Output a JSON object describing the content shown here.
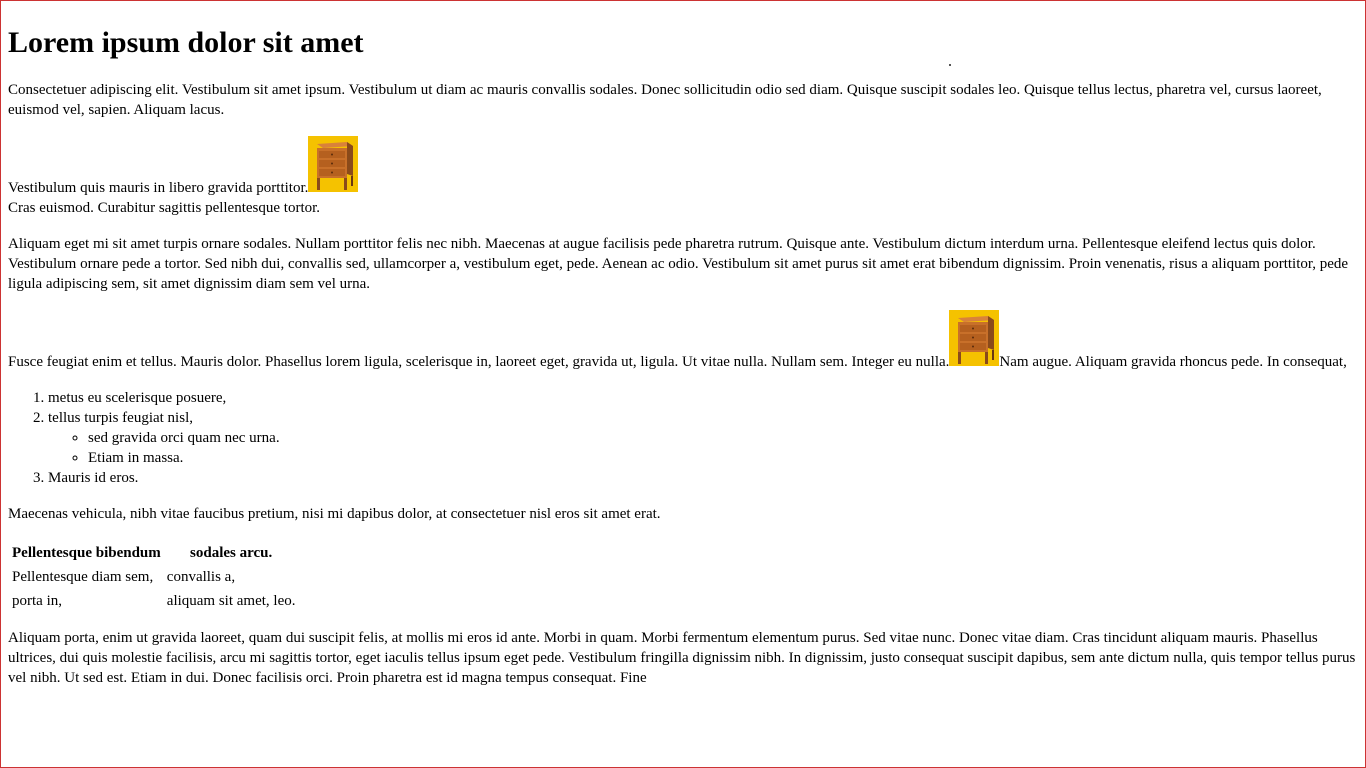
{
  "page": {
    "title": "Lorem ipsum dolor sit amet",
    "para1": "Consectetuer adipiscing elit. Vestibulum sit amet ipsum. Vestibulum ut diam ac mauris convallis sodales. Donec sollicitudin odio sed diam. Quisque suscipit sodales leo. Quisque tellus lectus, pharetra vel, cursus laoreet, euismod vel, sapien. Aliquam lacus.",
    "para2_line1": "Vestibulum quis mauris in libero gravida porttitor.",
    "para2_line2": "Cras euismod. Curabitur sagittis pellentesque tortor.",
    "para3": "Aliquam eget mi sit amet turpis ornare sodales. Nullam porttitor felis nec nibh. Maecenas at augue facilisis pede pharetra rutrum. Quisque ante. Vestibulum dictum interdum urna. Pellentesque eleifend lectus quis dolor. Vestibulum ornare pede a tortor. Sed nibh dui, convallis sed, ullamcorper a, vestibulum eget, pede. Aenean ac odio. Vestibulum sit amet purus sit amet erat bibendum dignissim. Proin venenatis, risus a aliquam porttitor, pede ligula adipiscing sem, sit amet dignissim diam sem vel urna.",
    "para4_before": "Fusce feugiat enim et tellus. Mauris dolor. Phasellus lorem ligula, scelerisque in, laoreet eget, gravida ut, ligula. Ut vitae nulla. Nullam sem. Integer eu nulla.",
    "para4_after": "Nam augue. Aliquam gravida rhoncus pede. In consequat,",
    "list": {
      "item1": "metus eu scelerisque posuere,",
      "item2": "tellus turpis feugiat nisl,",
      "sub1": "sed gravida orci quam nec urna.",
      "sub2": "Etiam in massa.",
      "item3": "Mauris id eros."
    },
    "para5": "Maecenas vehicula, nibh vitae faucibus pretium, nisi mi dapibus dolor, at consectetuer nisl eros sit amet erat.",
    "table": {
      "headers": [
        "Pellentesque bibendum",
        "sodales arcu."
      ],
      "rows": [
        [
          "Pellentesque diam sem,",
          "convallis a,"
        ],
        [
          "porta in,",
          "aliquam sit amet, leo."
        ]
      ]
    },
    "para6": "Aliquam porta, enim ut gravida laoreet, quam dui suscipit felis, at mollis mi eros id ante. Morbi in quam. Morbi fermentum elementum purus. Sed vitae nunc. Donec vitae diam. Cras tincidunt aliquam mauris. Phasellus ultrices, dui quis molestie facilisis, arcu mi sagittis tortor, eget iaculis tellus ipsum eget pede. Vestibulum fringilla dignissim nibh. In dignissim, justo consequat suscipit dapibus, sem ante dictum nulla, quis tempor tellus purus vel nibh. Ut sed est. Etiam in dui. Donec facilisis orci. Proin pharetra est id magna tempus consequat. Fine"
  },
  "icons": {
    "image1": "nightstand-icon",
    "image2": "nightstand-icon"
  },
  "colors": {
    "frame_border": "#cc3333",
    "image_background": "#f5c200"
  }
}
